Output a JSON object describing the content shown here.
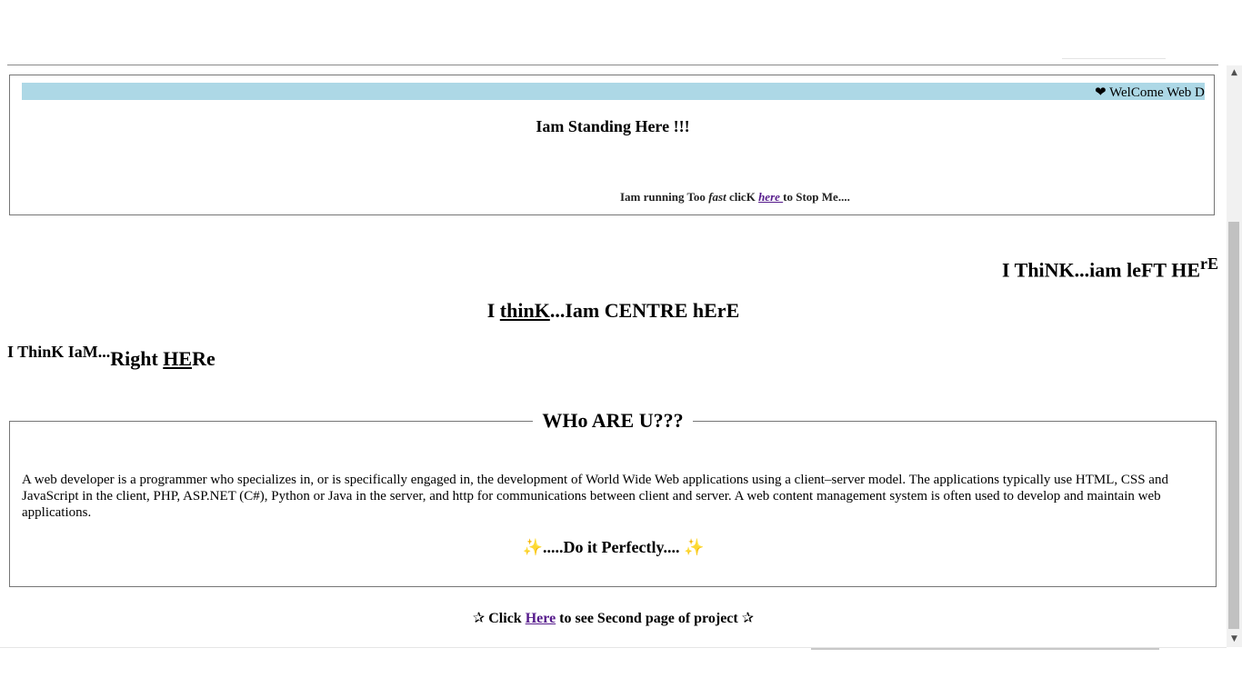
{
  "marquee": {
    "text": "WelCome Web Developer",
    "heart_icon": "❤"
  },
  "standing": "Iam Standing Here !!!",
  "running": {
    "prefix": "Iam running Too ",
    "fast": "fast",
    "mid": " clicK ",
    "link": "here ",
    "suffix": " to Stop Me...."
  },
  "left_here": {
    "main": "I ThiNK...iam leFT HE",
    "sup": "rE"
  },
  "centre_here": {
    "pre": "I ",
    "underlined": "thinK",
    "post": "...Iam CENTRE hErE"
  },
  "right_here": {
    "small": "I ThinK IaM...",
    "big1": "Right ",
    "underlined": "HE",
    "big2": "Re"
  },
  "who": {
    "legend": "WHo ARE U???",
    "paragraph": "A web developer is a programmer who specializes in, or is specifically engaged in, the development of World Wide Web applications using a client–server model. The applications typically use HTML, CSS and JavaScript in the client, PHP, ASP.NET (C#), Python or Java in the server, and http for communications between client and server. A web content management system is often used to develop and maintain web applications.",
    "sparkle_icon": "✨",
    "perfect": ".....Do it Perfectly.... "
  },
  "footer": {
    "star_icon": "✰",
    "click": " Click ",
    "link": "Here",
    "rest": " to see Second page of project "
  },
  "scroll": {
    "up_icon": "▲",
    "down_icon": "▼"
  }
}
